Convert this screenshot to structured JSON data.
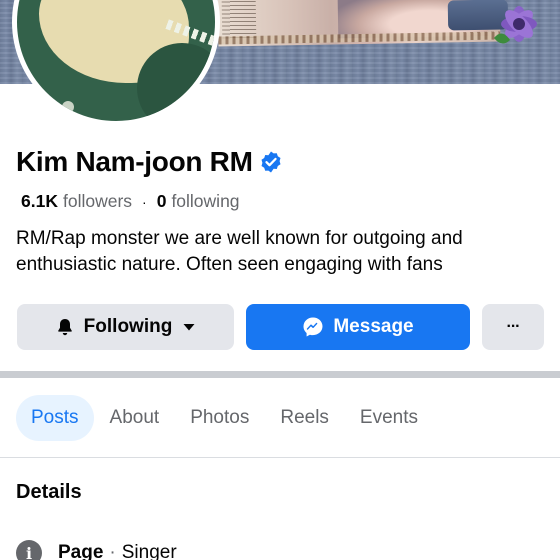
{
  "profile": {
    "name": "Kim Nam-joon RM",
    "verified": true,
    "followers_count": "6.1K",
    "followers_label": "followers",
    "following_count": "0",
    "following_label": "following",
    "separator": "·",
    "bio": "RM/Rap monster we are well known for outgoing and enthusiastic nature. Often seen engaging with fans"
  },
  "actions": {
    "following_label": "Following",
    "message_label": "Message",
    "more_label": "···"
  },
  "tabs": [
    {
      "label": "Posts",
      "active": true
    },
    {
      "label": "About",
      "active": false
    },
    {
      "label": "Photos",
      "active": false
    },
    {
      "label": "Reels",
      "active": false
    },
    {
      "label": "Events",
      "active": false
    }
  ],
  "details": {
    "title": "Details",
    "page_label": "Page",
    "separator": "·",
    "page_category": "Singer"
  },
  "icons": {
    "verified": "verified-badge-icon",
    "bell": "bell-icon",
    "caret": "caret-down-icon",
    "messenger": "messenger-icon",
    "more": "more-icon",
    "info": "info-icon"
  },
  "colors": {
    "accent": "#1877f2",
    "secondary_button": "#e4e6eb",
    "active_tab_bg": "#e7f3ff",
    "muted_text": "#65676b"
  }
}
